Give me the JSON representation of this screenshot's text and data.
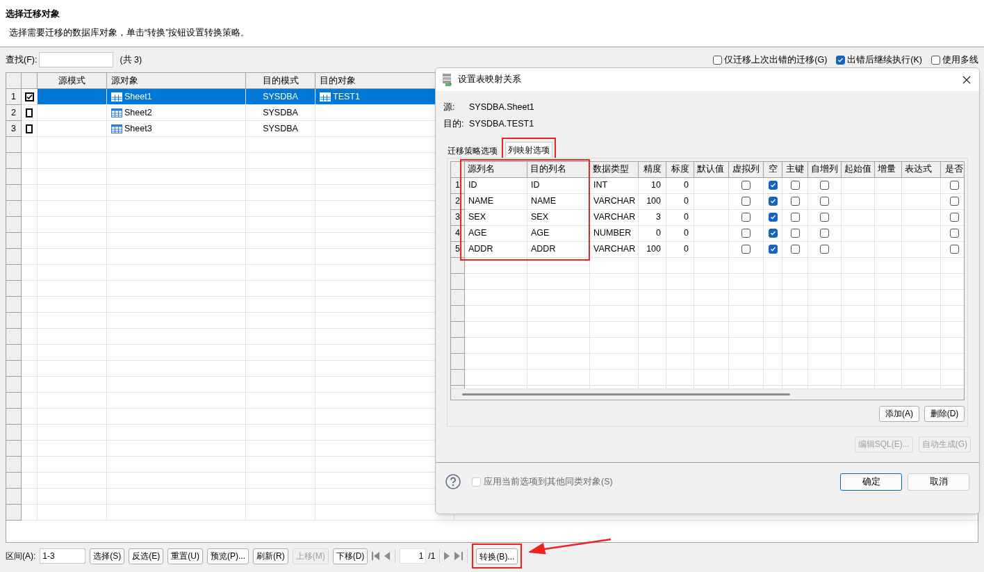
{
  "page": {
    "title": "选择迁移对象",
    "description": "选择需要迁移的数据库对象，单击“转换”按钮设置转换策略。"
  },
  "search": {
    "label": "查找(F):",
    "count": "(共 3)"
  },
  "options": [
    {
      "label": "仅迁移上次出错的迁移(G)",
      "checked": false
    },
    {
      "label": "出错后继续执行(K)",
      "checked": true
    },
    {
      "label": "使用多线",
      "checked": false
    }
  ],
  "table": {
    "columns": [
      "源模式",
      "源对象",
      "目的模式",
      "目的对象"
    ],
    "rows": [
      {
        "number": "1",
        "checked": true,
        "selected": true,
        "source_object": "Sheet1",
        "target_schema": "SYSDBA",
        "target_object": "TEST1"
      },
      {
        "number": "2",
        "checked": false,
        "selected": false,
        "source_object": "Sheet2",
        "target_schema": "SYSDBA"
      },
      {
        "number": "3",
        "checked": false,
        "selected": false,
        "source_object": "Sheet3",
        "target_schema": "SYSDBA"
      }
    ]
  },
  "bottom_bar": {
    "range_label": "区间(A):",
    "range_value": "1-3",
    "buttons": [
      {
        "label": "选择(S)",
        "disabled": false
      },
      {
        "label": "反选(E)",
        "disabled": false
      },
      {
        "label": "重置(U)",
        "disabled": false
      },
      {
        "label": "预览(P)...",
        "disabled": false
      },
      {
        "label": "刷新(R)",
        "disabled": false
      },
      {
        "label": "上移(M)",
        "disabled": true
      },
      {
        "label": "下移(D)",
        "disabled": false
      }
    ],
    "page_value": "1",
    "page_total": "/1",
    "convert_button": "转换(B)..."
  },
  "dialog": {
    "title": "设置表映射关系",
    "source_label": "源:",
    "source_value": "SYSDBA.Sheet1",
    "target_label": "目的:",
    "target_value": "SYSDBA.TEST1",
    "tabs": [
      {
        "label": "迁移策略选项",
        "selected": false
      },
      {
        "label": "列映射选项",
        "selected": true
      }
    ],
    "grid": {
      "columns": [
        {
          "label": "源列名",
          "kind": "text"
        },
        {
          "label": "目的列名",
          "kind": "text"
        },
        {
          "label": "数据类型",
          "kind": "text"
        },
        {
          "label": "精度",
          "kind": "number"
        },
        {
          "label": "标度",
          "kind": "number"
        },
        {
          "label": "默认值",
          "kind": "text"
        },
        {
          "label": "虚拟列",
          "kind": "check"
        },
        {
          "label": "空",
          "kind": "check"
        },
        {
          "label": "主键",
          "kind": "check"
        },
        {
          "label": "自增列",
          "kind": "check"
        },
        {
          "label": "起始值",
          "kind": "text"
        },
        {
          "label": "增量",
          "kind": "text"
        },
        {
          "label": "表达式",
          "kind": "text"
        },
        {
          "label": "是否",
          "kind": "check"
        }
      ],
      "rows": [
        {
          "number": "1",
          "source": "ID",
          "target": "ID",
          "type": "INT",
          "precision": "10",
          "scale": "0",
          "virtual": false,
          "nullable": true,
          "primary_key": false,
          "auto_increment": false,
          "column_14": false
        },
        {
          "number": "2",
          "source": "NAME",
          "target": "NAME",
          "type": "VARCHAR",
          "precision": "100",
          "scale": "0",
          "virtual": false,
          "nullable": true,
          "primary_key": false,
          "auto_increment": false,
          "column_14": false
        },
        {
          "number": "3",
          "source": "SEX",
          "target": "SEX",
          "type": "VARCHAR",
          "precision": "3",
          "scale": "0",
          "virtual": false,
          "nullable": true,
          "primary_key": false,
          "auto_increment": false,
          "column_14": false
        },
        {
          "number": "4",
          "source": "AGE",
          "target": "AGE",
          "type": "NUMBER",
          "precision": "0",
          "scale": "0",
          "virtual": false,
          "nullable": true,
          "primary_key": false,
          "auto_increment": false,
          "column_14": false
        },
        {
          "number": "5",
          "source": "ADDR",
          "target": "ADDR",
          "type": "VARCHAR",
          "precision": "100",
          "scale": "0",
          "virtual": false,
          "nullable": true,
          "primary_key": false,
          "auto_increment": false,
          "column_14": false
        }
      ]
    },
    "grid_buttons": [
      {
        "label": "添加(A)",
        "disabled": false
      },
      {
        "label": "删除(D)",
        "disabled": false
      }
    ],
    "sql_buttons": [
      {
        "label": "编辑SQL(E)...",
        "disabled": true
      },
      {
        "label": "自动生成(G)",
        "disabled": true
      }
    ],
    "apply_option": {
      "label": "应用当前选项到其他同类对象(S)",
      "checked": false,
      "disabled": true
    },
    "footer_buttons": [
      {
        "label": "确定",
        "selected": true
      },
      {
        "label": "取消",
        "selected": false
      }
    ]
  }
}
